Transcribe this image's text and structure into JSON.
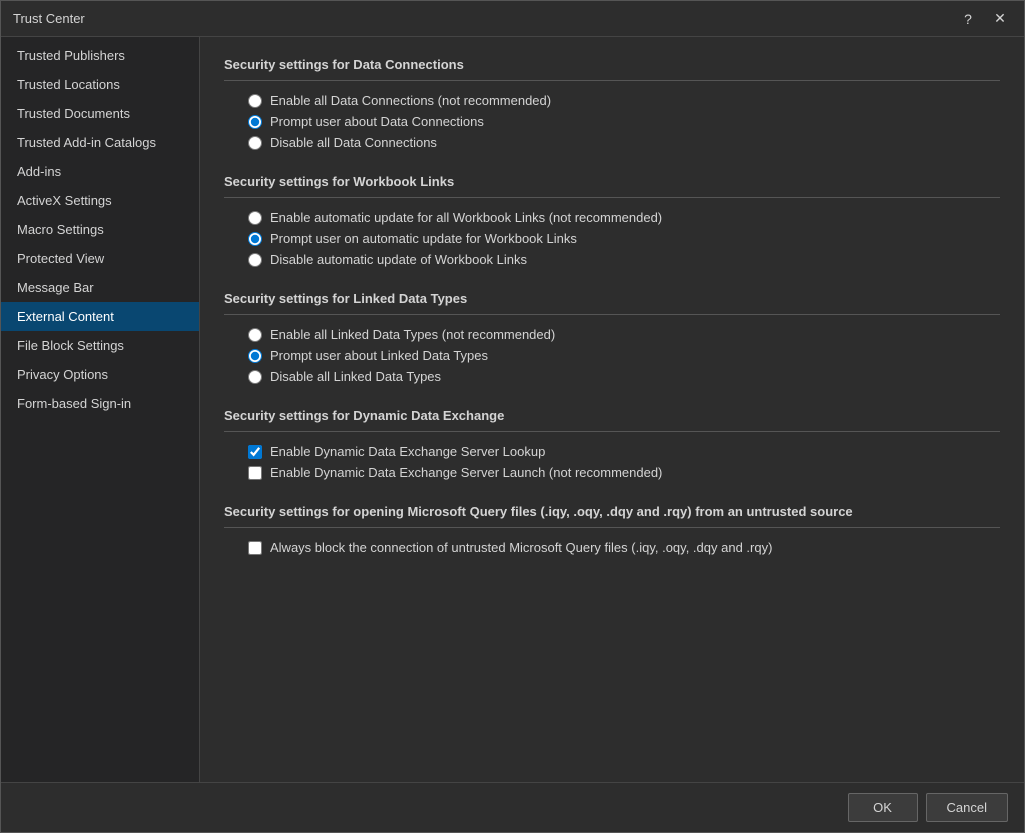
{
  "dialog": {
    "title": "Trust Center"
  },
  "titlebar": {
    "help_btn": "?",
    "close_btn": "✕"
  },
  "sidebar": {
    "items": [
      {
        "id": "trusted-publishers",
        "label": "Trusted Publishers",
        "active": false
      },
      {
        "id": "trusted-locations",
        "label": "Trusted Locations",
        "active": false
      },
      {
        "id": "trusted-documents",
        "label": "Trusted Documents",
        "active": false
      },
      {
        "id": "trusted-add-in-catalogs",
        "label": "Trusted Add-in Catalogs",
        "active": false
      },
      {
        "id": "add-ins",
        "label": "Add-ins",
        "active": false
      },
      {
        "id": "activex-settings",
        "label": "ActiveX Settings",
        "active": false
      },
      {
        "id": "macro-settings",
        "label": "Macro Settings",
        "active": false
      },
      {
        "id": "protected-view",
        "label": "Protected View",
        "active": false
      },
      {
        "id": "message-bar",
        "label": "Message Bar",
        "active": false
      },
      {
        "id": "external-content",
        "label": "External Content",
        "active": true
      },
      {
        "id": "file-block-settings",
        "label": "File Block Settings",
        "active": false
      },
      {
        "id": "privacy-options",
        "label": "Privacy Options",
        "active": false
      },
      {
        "id": "form-based-sign-in",
        "label": "Form-based Sign-in",
        "active": false
      }
    ]
  },
  "main": {
    "sections": [
      {
        "id": "data-connections",
        "title": "Security settings for Data Connections",
        "type": "radio",
        "options": [
          {
            "id": "dc-enable",
            "label": "Enable all Data Connections (not recommended)",
            "checked": false,
            "underline": "E"
          },
          {
            "id": "dc-prompt",
            "label": "Prompt user about Data Connections",
            "checked": true,
            "underline": "P"
          },
          {
            "id": "dc-disable",
            "label": "Disable all Data Connections",
            "checked": false,
            "underline": "D"
          }
        ]
      },
      {
        "id": "workbook-links",
        "title": "Security settings for Workbook Links",
        "type": "radio",
        "options": [
          {
            "id": "wl-enable",
            "label": "Enable automatic update for all Workbook Links (not recommended)",
            "checked": false,
            "underline": "E"
          },
          {
            "id": "wl-prompt",
            "label": "Prompt user on automatic update for Workbook Links",
            "checked": true,
            "underline": "P"
          },
          {
            "id": "wl-disable",
            "label": "Disable automatic update of Workbook Links",
            "checked": false,
            "underline": "D"
          }
        ]
      },
      {
        "id": "linked-data-types",
        "title": "Security settings for Linked Data Types",
        "type": "radio",
        "options": [
          {
            "id": "ldt-enable",
            "label": "Enable all Linked Data Types (not recommended)",
            "checked": false,
            "underline": "E"
          },
          {
            "id": "ldt-prompt",
            "label": "Prompt user about Linked Data Types",
            "checked": true,
            "underline": "P"
          },
          {
            "id": "ldt-disable",
            "label": "Disable all Linked Data Types",
            "checked": false,
            "underline": "D"
          }
        ]
      },
      {
        "id": "dynamic-data-exchange",
        "title": "Security settings for Dynamic Data Exchange",
        "type": "checkbox",
        "options": [
          {
            "id": "dde-lookup",
            "label": "Enable Dynamic Data Exchange Server Lookup",
            "checked": true
          },
          {
            "id": "dde-launch",
            "label": "Enable Dynamic Data Exchange Server Launch (not recommended)",
            "checked": false
          }
        ]
      },
      {
        "id": "microsoft-query",
        "title": "Security settings for opening  Microsoft Query files (.iqy, .oqy, .dqy and .rqy) from an untrusted source",
        "type": "checkbox",
        "options": [
          {
            "id": "mq-block",
            "label": "Always block the connection of untrusted Microsoft Query files (.iqy, .oqy, .dqy and .rqy)",
            "checked": false
          }
        ]
      }
    ]
  },
  "footer": {
    "ok_label": "OK",
    "cancel_label": "Cancel"
  }
}
